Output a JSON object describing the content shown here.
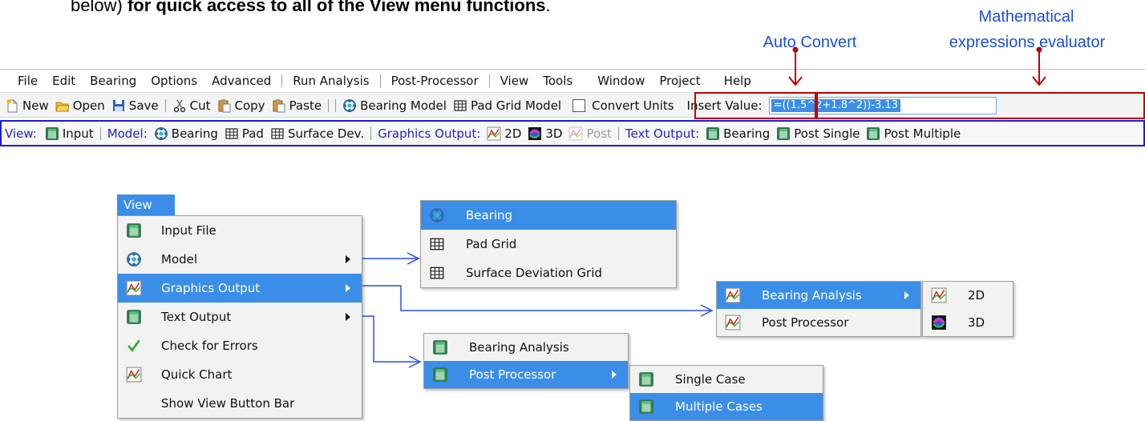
{
  "caption": {
    "pre": "below)",
    "bold": "for quick access to all of the View menu functions",
    "post": "."
  },
  "annotations": {
    "auto_convert": "Auto Convert",
    "math_line1": "Mathematical",
    "math_line2": "expressions evaluator"
  },
  "colors": {
    "accent": "#1c4fd8",
    "arrow": "#c00000",
    "highlight": "#3b8ee8",
    "viewbar_border": "#1b1bd6"
  },
  "menubar": [
    "File",
    "Edit",
    "Bearing",
    "Options",
    "Advanced",
    "Run Analysis",
    "Post-Processor",
    "View",
    "Tools",
    "Window",
    "Project",
    "Help"
  ],
  "toolbar": {
    "new": "New",
    "open": "Open",
    "save": "Save",
    "cut": "Cut",
    "copy": "Copy",
    "paste": "Paste",
    "bearing_model": "Bearing Model",
    "pad_grid_model": "Pad Grid Model",
    "convert_units": "Convert Units",
    "insert_value_label": "Insert Value:",
    "insert_value": "=((1.5^2+1.8^2))-3.13"
  },
  "viewbar": {
    "view_label": "View:",
    "input": "Input",
    "model_label": "Model:",
    "bearing": "Bearing",
    "pad": "Pad",
    "surface_dev": "Surface Dev.",
    "graphics_label": "Graphics Output:",
    "g2d": "2D",
    "g3d": "3D",
    "post": "Post",
    "text_label": "Text Output:",
    "text_bearing": "Bearing",
    "post_single": "Post Single",
    "post_multiple": "Post Multiple"
  },
  "view_menu": {
    "title": "View",
    "items": [
      "Input File",
      "Model",
      "Graphics Output",
      "Text Output",
      "Check for Errors",
      "Quick Chart",
      "Show View Button Bar"
    ]
  },
  "model_menu": [
    "Bearing",
    "Pad Grid",
    "Surface Deviation Grid"
  ],
  "graphics_menu": [
    "Bearing Analysis",
    "Post Processor"
  ],
  "bearing_analysis_menu": [
    "2D",
    "3D"
  ],
  "text_menu": [
    "Bearing Analysis",
    "Post Processor"
  ],
  "post_processor_menu": [
    "Single Case",
    "Multiple Cases"
  ]
}
